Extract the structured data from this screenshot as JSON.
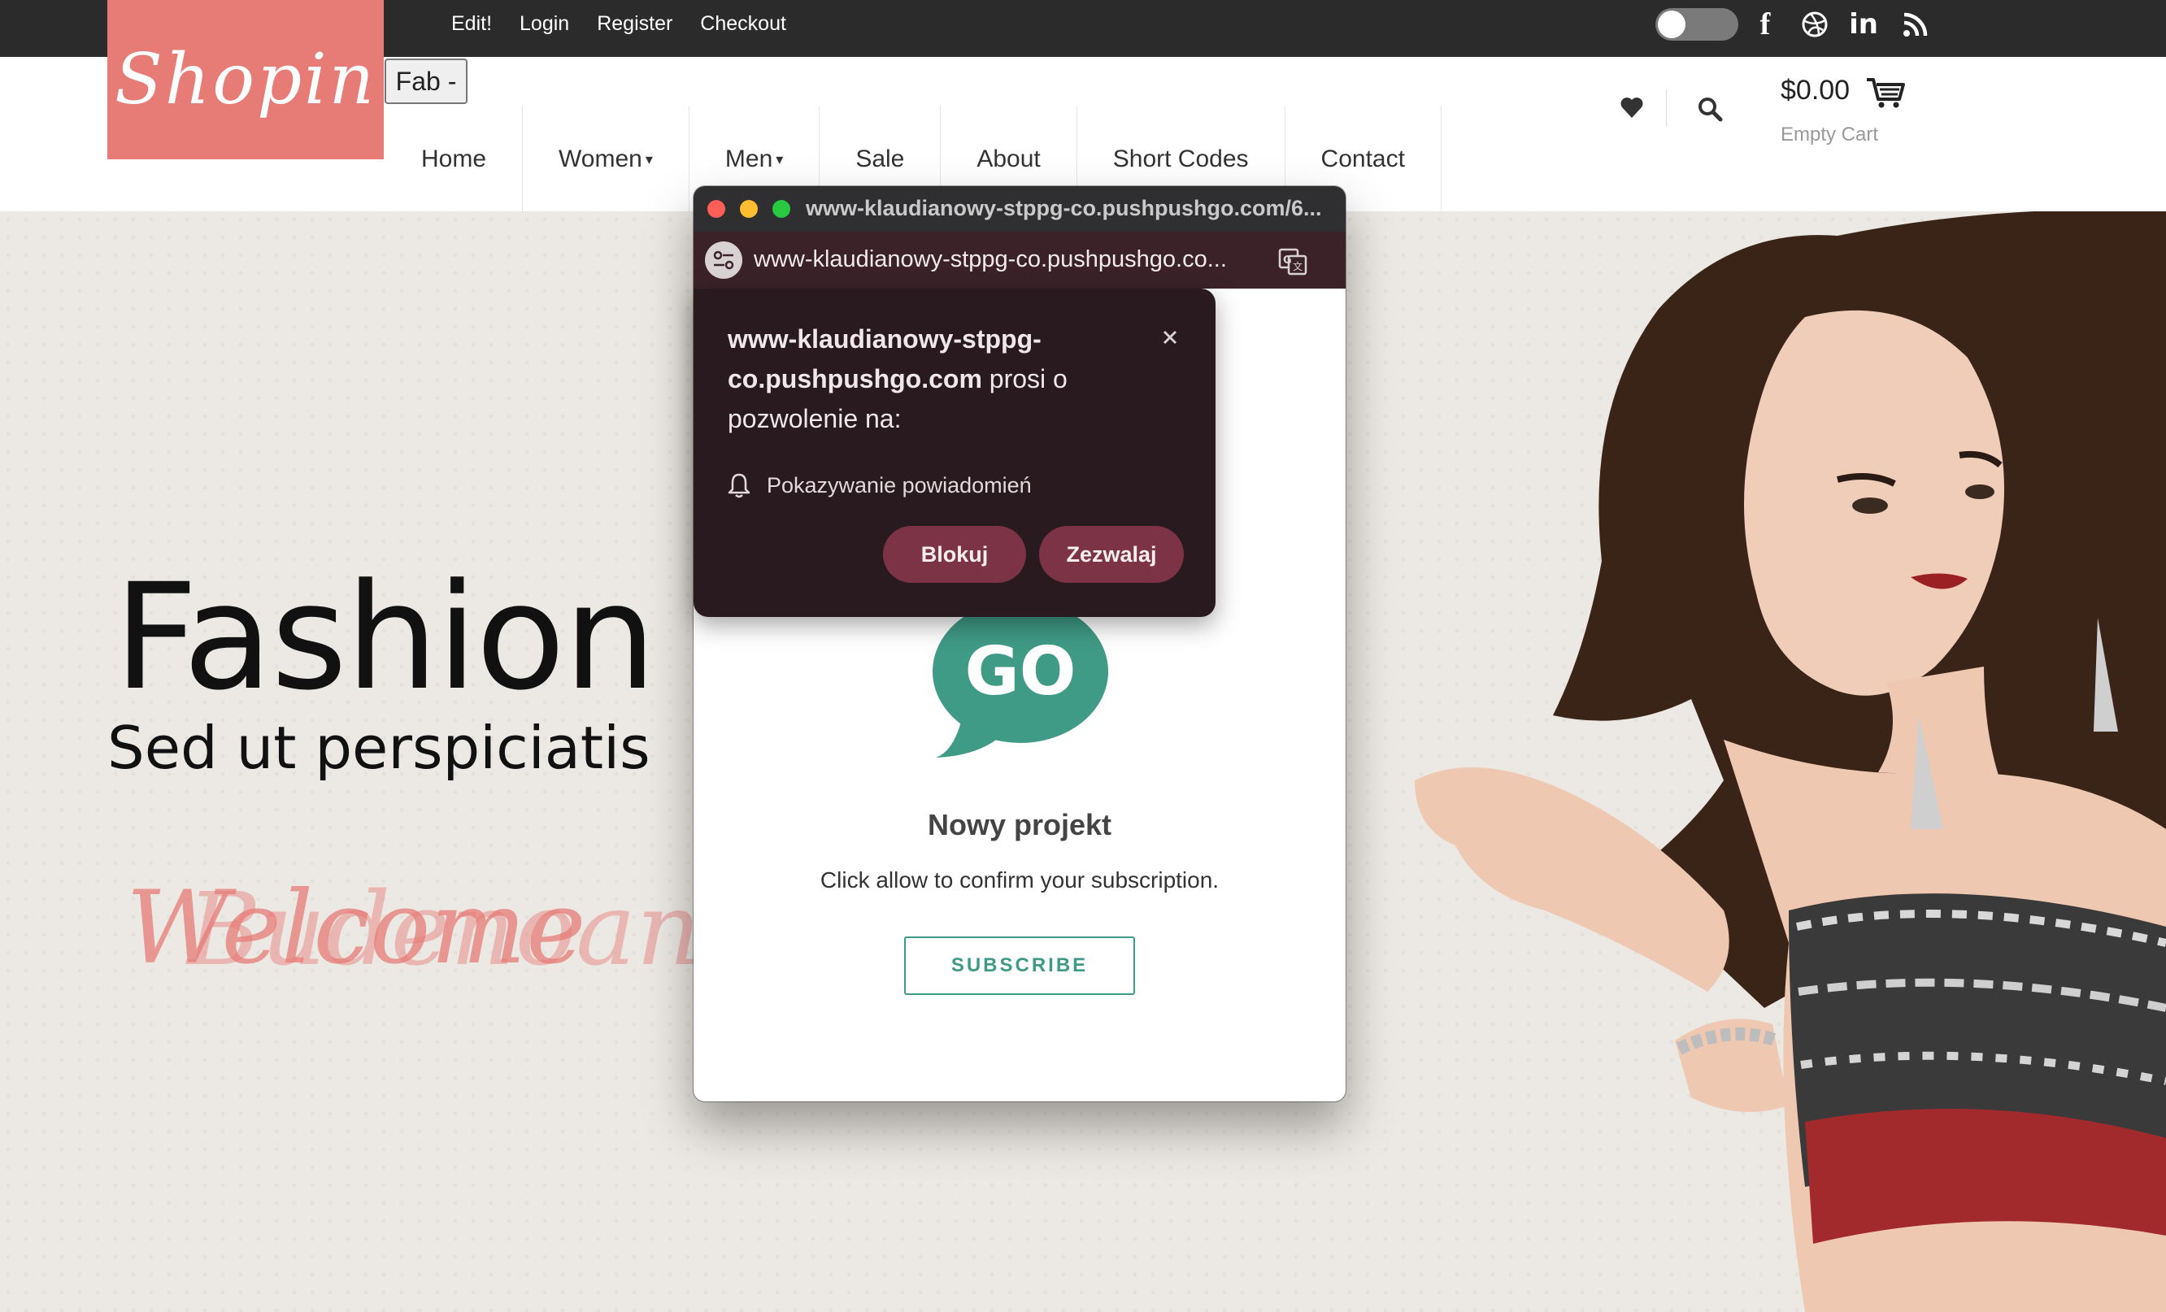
{
  "topbar": {
    "links": [
      "Edit!",
      "Login",
      "Register",
      "Checkout"
    ],
    "social_icons": [
      "facebook-icon",
      "dribbble-icon",
      "linkedin-icon",
      "rss-icon"
    ]
  },
  "header": {
    "logo_text": "Shopin",
    "tag_label": "Fab -",
    "nav": [
      "Home",
      "Women",
      "Men",
      "Sale",
      "About",
      "Short Codes",
      "Contact"
    ],
    "cart_total": "$0.00",
    "cart_status": "Empty Cart"
  },
  "hero": {
    "title": "Fashion &",
    "subtitle": "Sed ut perspiciatis",
    "script_a": "Welcome",
    "script_b": "Budenoanc"
  },
  "popup": {
    "window_title": "www-klaudianowy-stppg-co.pushpushgo.com/6...",
    "url_text": "www-klaudianowy-stppg-co.pushpushgo.co...",
    "go_logo_text": "GO",
    "project_title": "Nowy projekt",
    "description": "Click allow to confirm your subscription.",
    "subscribe_label": "SUBSCRIBE"
  },
  "permission": {
    "site_line1": "www-klaudianowy-stppg-",
    "site_line2": "co.pushpushgo.com",
    "request_suffix": " prosi o",
    "request_line3": "pozwolenie na:",
    "permission_label": "Pokazywanie powiadomień",
    "block_label": "Blokuj",
    "allow_label": "Zezwalaj"
  },
  "colors": {
    "brand": "#e77b75",
    "topbar": "#2b2b2b",
    "go_green": "#3f9a86",
    "dialog_bg": "#281a1e",
    "dialog_button": "#7c3345"
  }
}
